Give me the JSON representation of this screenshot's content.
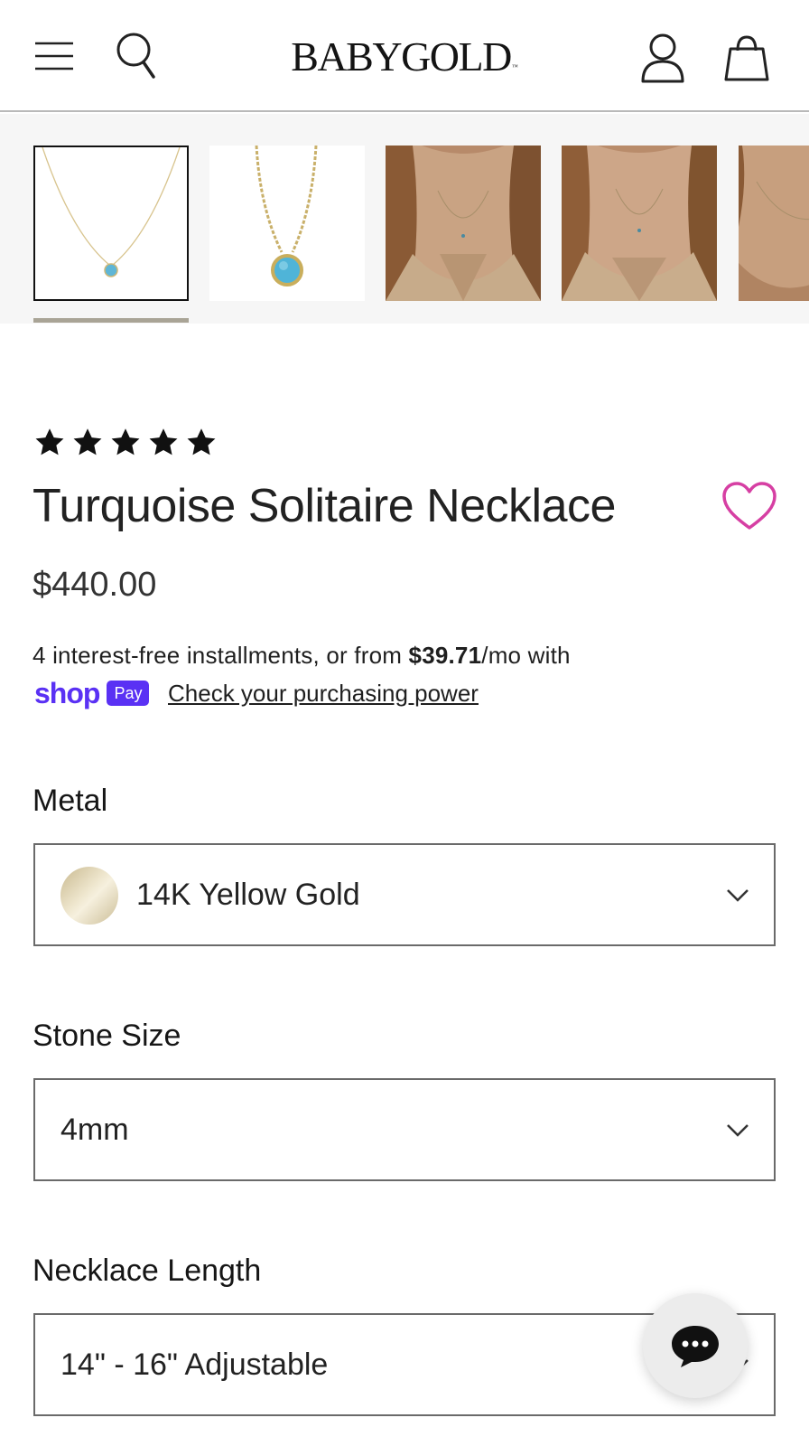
{
  "header": {
    "logo_text": "BABYGOLD",
    "logo_mark": "™",
    "icons": [
      "menu-icon",
      "search-icon",
      "account-icon",
      "bag-icon"
    ]
  },
  "gallery": {
    "thumbnails": [
      {
        "alt": "turquoise-necklace-product-flat",
        "selected": true
      },
      {
        "alt": "turquoise-necklace-product-closeup",
        "selected": false
      },
      {
        "alt": "model-wearing-necklace",
        "selected": false
      },
      {
        "alt": "model-wearing-necklace-alt",
        "selected": false
      },
      {
        "alt": "model-wearing-necklace-partial",
        "selected": false
      }
    ]
  },
  "product": {
    "rating": 5,
    "rating_max": 5,
    "title": "Turquoise Solitaire Necklace",
    "price": "$440.00",
    "installments_prefix": "4 interest-free installments, or from ",
    "installments_amount": "$39.71",
    "installments_suffix": "/mo with",
    "shop_pay_word": "shop",
    "shop_pay_badge": "Pay",
    "check_link": "Check your purchasing power"
  },
  "options": {
    "metal": {
      "label": "Metal",
      "value": "14K Yellow Gold"
    },
    "stone_size": {
      "label": "Stone Size",
      "value": "4mm"
    },
    "necklace_length": {
      "label": "Necklace Length",
      "value": "14\" - 16\" Adjustable"
    }
  },
  "colors": {
    "accent_pink": "#d63fa3",
    "shop_pay_purple": "#5a31f4",
    "gallery_indicator": "#a9a496"
  }
}
